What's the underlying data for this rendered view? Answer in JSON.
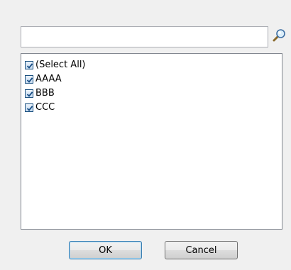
{
  "search": {
    "value": "",
    "placeholder": ""
  },
  "items": [
    {
      "label": "(Select All)",
      "checked": true
    },
    {
      "label": "AAAA",
      "checked": true
    },
    {
      "label": "BBB",
      "checked": true
    },
    {
      "label": "CCC",
      "checked": true
    }
  ],
  "buttons": {
    "ok_label": "OK",
    "cancel_label": "Cancel"
  },
  "colors": {
    "checkbox_border": "#1c5180",
    "check_mark": "#1a4f86",
    "ok_focus_border": "#3c7fb1"
  },
  "icons": {
    "search_button": "magnifier-icon",
    "checkbox_mark": "check-icon"
  }
}
